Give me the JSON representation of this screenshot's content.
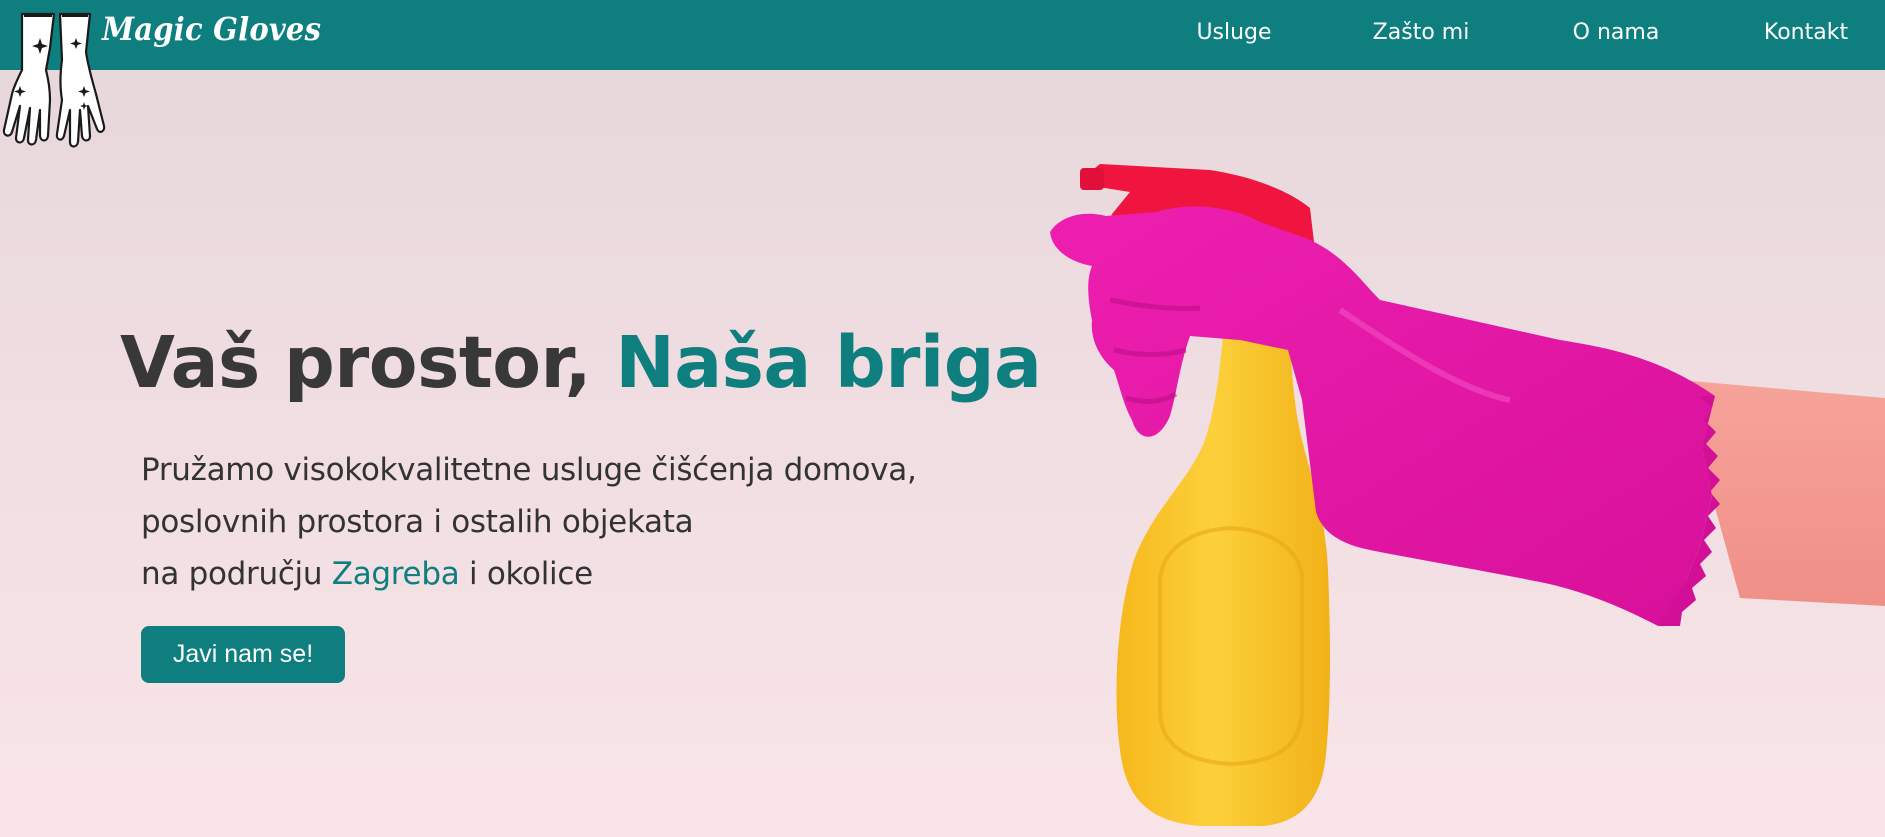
{
  "brand": {
    "name": "Magic Gloves",
    "logo_icon": "white-gloves-icon"
  },
  "nav": {
    "items": [
      {
        "label": "Usluge"
      },
      {
        "label": "Zašto mi"
      },
      {
        "label": "O nama"
      },
      {
        "label": "Kontakt"
      }
    ]
  },
  "hero": {
    "headline_plain": "Vaš prostor, ",
    "headline_accent": "Naša briga",
    "subtitle_line1": "Pružamo visokokvalitetne usluge čišćenja domova,",
    "subtitle_line2": "poslovnih prostora i ostalih objekata",
    "subtitle_line3_before": "na području ",
    "subtitle_line3_accent": "Zagreba",
    "subtitle_line3_after": " i okolice",
    "cta_label": "Javi nam se!",
    "image_icon": "spray-bottle-glove-icon"
  },
  "colors": {
    "primary": "#0e7e7e",
    "text_dark": "#383838",
    "background_top": "#e5d6da",
    "background_bottom": "#f9e5e8",
    "glove": "#e815a8",
    "bottle": "#fbc92b",
    "trigger": "#f0153f"
  }
}
